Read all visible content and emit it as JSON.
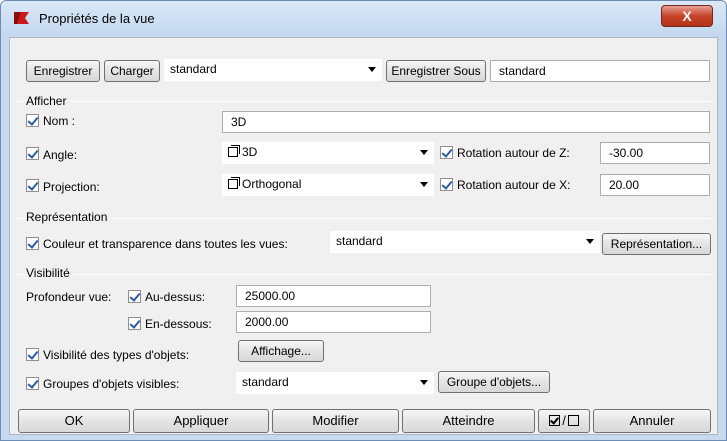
{
  "window": {
    "title": "Propriétés de la vue",
    "close_label": "X"
  },
  "top_bar": {
    "save_label": "Enregistrer",
    "load_label": "Charger",
    "preset_value": "standard",
    "save_as_label": "Enregistrer Sous",
    "save_as_name_value": "standard"
  },
  "afficher": {
    "group_label": "Afficher",
    "name_label": "Nom :",
    "name_value": "3D",
    "angle_label": "Angle:",
    "angle_value": "3D",
    "rotation_z_label": "Rotation autour de Z:",
    "rotation_z_value": "-30.00",
    "projection_label": "Projection:",
    "projection_value": "Orthogonal",
    "rotation_x_label": "Rotation autour de X:",
    "rotation_x_value": "20.00"
  },
  "representation": {
    "group_label": "Représentation",
    "color_label": "Couleur et transparence dans toutes les vues:",
    "color_value": "standard",
    "button_label": "Représentation..."
  },
  "visibilite": {
    "group_label": "Visibilité",
    "depth_label": "Profondeur vue:",
    "above_label": "Au-dessus:",
    "above_value": "25000.00",
    "below_label": "En-dessous:",
    "below_value": "2000.00",
    "object_types_label": "Visibilité des types d'objets:",
    "affichage_label": "Affichage...",
    "groups_label": "Groupes d'objets visibles:",
    "groups_value": "standard",
    "groups_button_label": "Groupe d'objets..."
  },
  "footer": {
    "ok_label": "OK",
    "apply_label": "Appliquer",
    "modify_label": "Modifier",
    "reach_label": "Atteindre",
    "toggle_separator": "/",
    "cancel_label": "Annuler"
  },
  "colors": {
    "window_frame": "#c6d9ef",
    "close_button": "#c7432a",
    "check_color": "#2b5ba8",
    "app_icon": "#cc1a1a"
  },
  "icons": {
    "app": "red-flag-icon",
    "close": "close-icon",
    "dropdown": "chevron-down-icon",
    "view_cube": "cube-icon",
    "toggle": "checkbox-toggle-icon"
  }
}
